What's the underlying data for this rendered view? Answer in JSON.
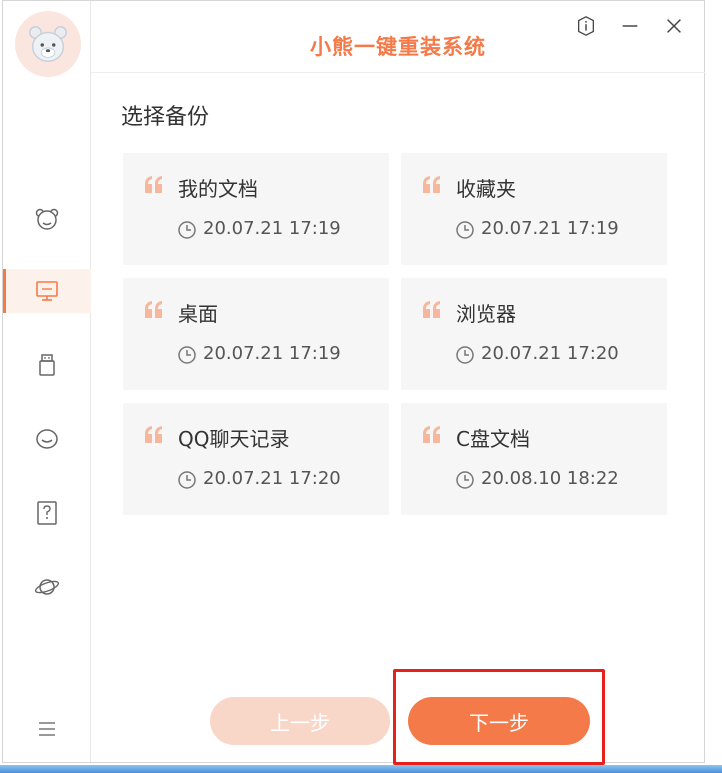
{
  "app": {
    "title": "小熊一键重装系统"
  },
  "window_controls": {
    "info_icon": "info-icon",
    "minimize_icon": "minimize-icon",
    "close_icon": "close-icon"
  },
  "sidebar": {
    "items": [
      {
        "icon": "bear-icon",
        "active": false
      },
      {
        "icon": "monitor-icon",
        "active": true
      },
      {
        "icon": "usb-drive-icon",
        "active": false
      },
      {
        "icon": "chat-icon",
        "active": false
      },
      {
        "icon": "help-icon",
        "active": false
      },
      {
        "icon": "planet-icon",
        "active": false
      },
      {
        "icon": "menu-icon",
        "active": false
      }
    ]
  },
  "main": {
    "section_title": "选择备份",
    "backups": [
      {
        "name": "我的文档",
        "time": "20.07.21 17:19"
      },
      {
        "name": "收藏夹",
        "time": "20.07.21 17:19"
      },
      {
        "name": "桌面",
        "time": "20.07.21 17:19"
      },
      {
        "name": "浏览器",
        "time": "20.07.21 17:20"
      },
      {
        "name": "QQ聊天记录",
        "time": "20.07.21 17:20"
      },
      {
        "name": "C盘文档",
        "time": "20.08.10 18:22"
      }
    ]
  },
  "footer": {
    "prev_label": "上一步",
    "next_label": "下一步"
  },
  "colors": {
    "accent": "#f47a4a",
    "accent_light": "#f9d7c8",
    "card_bg": "#f6f6f6",
    "annotation": "#e8201a"
  }
}
